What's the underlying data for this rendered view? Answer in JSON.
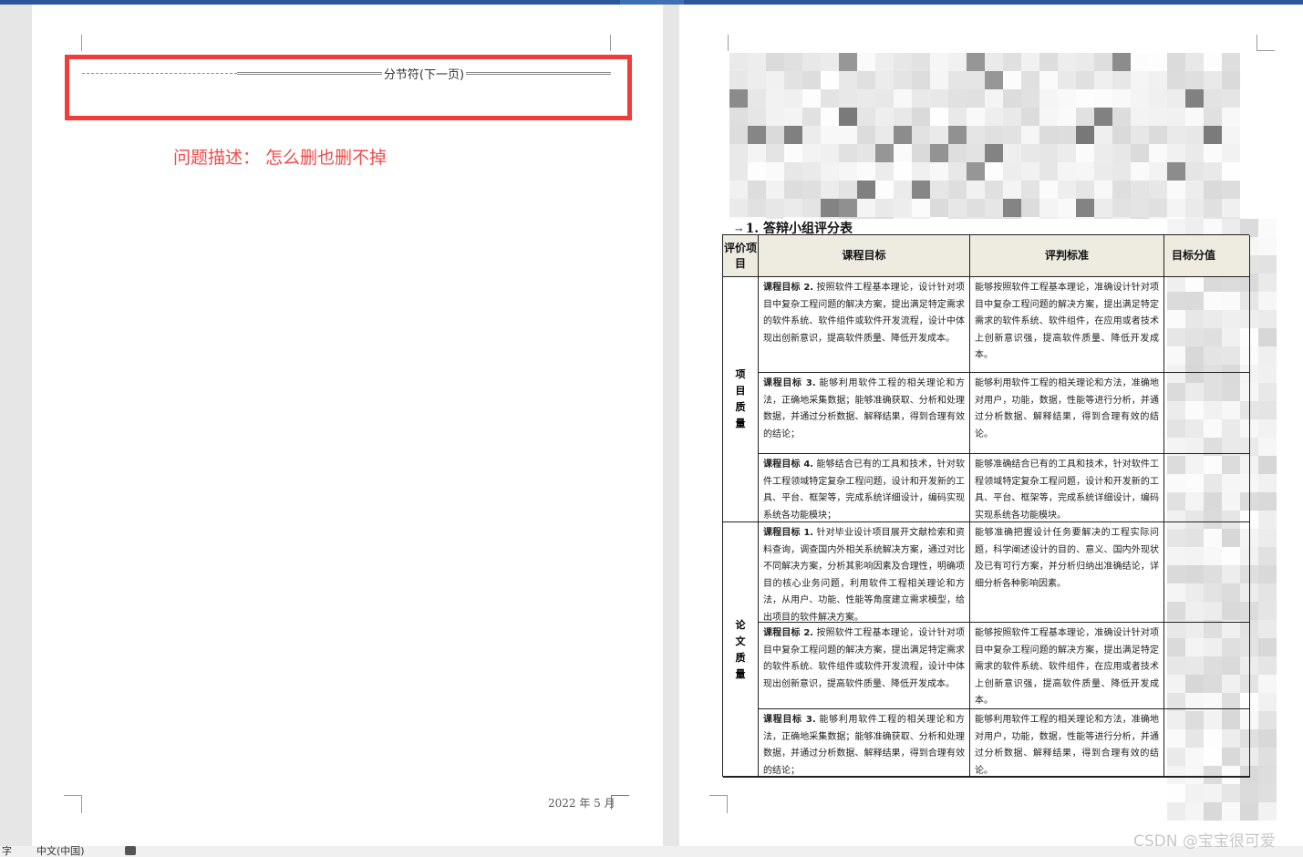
{
  "left_page": {
    "section_break_label": "分节符(下一页)",
    "problem_text": "问题描述：  怎么删也删不掉",
    "footer_date": "2022 年 5 月"
  },
  "right_page": {
    "table_title": "1. 答辩小组评分表",
    "headers": [
      "评价项目",
      "课程目标",
      "评判标准",
      "目标分值"
    ],
    "groups": [
      "项目质量",
      "论文质量"
    ],
    "rows": [
      {
        "goal_title": "课程目标 2.",
        "goal_text": "按照软件工程基本理论，设计针对项目中复杂工程问题的解决方案，提出满足特定需求的软件系统、软件组件或软件开发流程，设计中体现出创新意识，提高软件质量、降低开发成本。",
        "criteria": "能够按照软件工程基本理论，准确设计针对项目中复杂工程问题的解决方案，提出满足特定需求的软件系统、软件组件，在应用或者技术上创新意识强，提高软件质量、降低开发成本。"
      },
      {
        "goal_title": "课程目标 3.",
        "goal_text": "能够利用软件工程的相关理论和方法，正确地采集数据；能够准确获取、分析和处理数据，并通过分析数据、解释结果，得到合理有效的结论；",
        "criteria": "能够利用软件工程的相关理论和方法，准确地对用户，功能，数据，性能等进行分析，并通过分析数据、解释结果，得到合理有效的结论。"
      },
      {
        "goal_title": "课程目标 4.",
        "goal_text": "能够结合已有的工具和技术，针对软件工程领域特定复杂工程问题，设计和开发新的工具、平台、框架等，完成系统详细设计，编码实现系统各功能模块；",
        "criteria": "能够准确结合已有的工具和技术，针对软件工程领域特定复杂工程问题，设计和开发新的工具、平台、框架等，完成系统详细设计，编码实现系统各功能模块。"
      },
      {
        "goal_title": "课程目标 1.",
        "goal_text": "针对毕业设计项目展开文献检索和资料查询，调查国内外相关系统解决方案，通过对比不同解决方案，分析其影响因素及合理性，明确项目的核心业务问题，利用软件工程相关理论和方法，从用户、功能、性能等角度建立需求模型，给出项目的软件解决方案。",
        "criteria": "能够准确把握设计任务要解决的工程实际问题，科学阐述设计的目的、意义、国内外现状及已有可行方案，并分析归纳出准确结论，详细分析各种影响因素。"
      },
      {
        "goal_title": "课程目标 2.",
        "goal_text": "按照软件工程基本理论，设计针对项目中复杂工程问题的解决方案，提出满足特定需求的软件系统、软件组件或软件开发流程，设计中体现出创新意识，提高软件质量、降低开发成本。",
        "criteria": "能够按照软件工程基本理论，准确设计针对项目中复杂工程问题的解决方案，提出满足特定需求的软件系统、软件组件，在应用或者技术上创新意识强，提高软件质量、降低开发成本。"
      },
      {
        "goal_title": "课程目标 3.",
        "goal_text": "能够利用软件工程的相关理论和方法，正确地采集数据；能够准确获取、分析和处理数据，并通过分析数据、解释结果，得到合理有效的结论；",
        "criteria": "能够利用软件工程的相关理论和方法，准确地对用户，功能，数据，性能等进行分析，并通过分析数据、解释结果，得到合理有效的结论。"
      }
    ]
  },
  "status_bar": {
    "left_fragment": "字",
    "language": "中文(中国)"
  },
  "watermark": "CSDN @宝宝很可爱",
  "colors": {
    "highlight": "#f23b3b",
    "problem_text": "#f04a4a",
    "header_fill": "#eeece1",
    "title_bar": "#2b579a"
  }
}
